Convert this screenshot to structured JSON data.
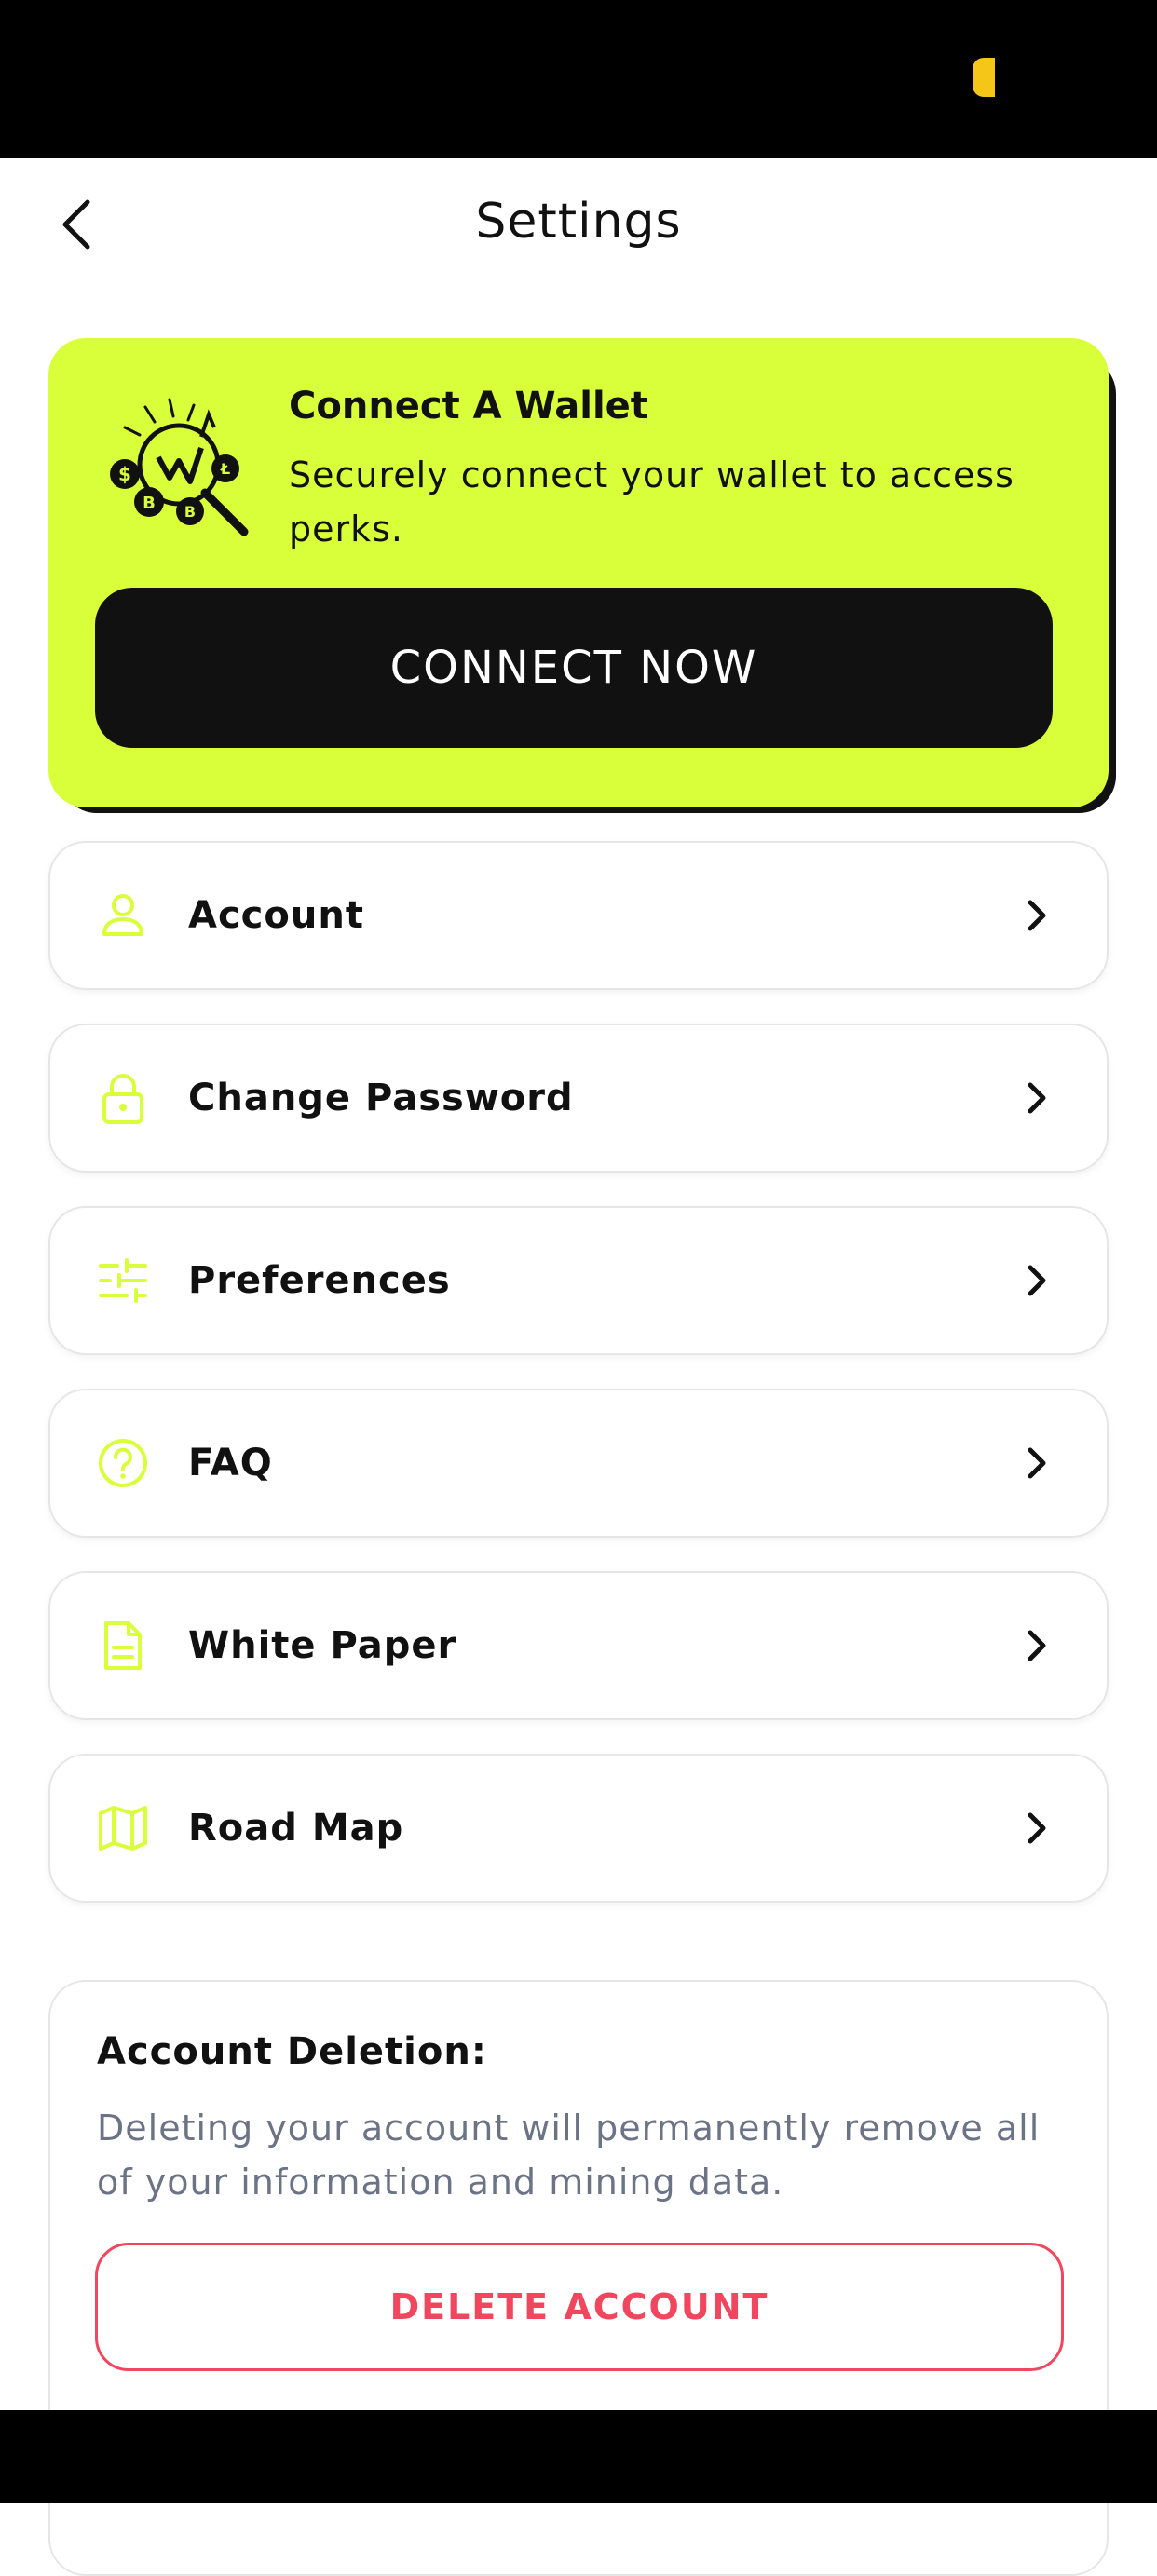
{
  "header": {
    "title": "Settings"
  },
  "wallet": {
    "title": "Connect A Wallet",
    "description": "Securely connect your wallet to access perks.",
    "button_label": "CONNECT NOW"
  },
  "menu": [
    {
      "label": "Account",
      "icon": "user-icon"
    },
    {
      "label": "Change Password",
      "icon": "lock-icon"
    },
    {
      "label": "Preferences",
      "icon": "sliders-icon"
    },
    {
      "label": "FAQ",
      "icon": "help-circle-icon"
    },
    {
      "label": "White Paper",
      "icon": "document-icon"
    },
    {
      "label": "Road Map",
      "icon": "map-icon"
    }
  ],
  "deletion": {
    "title": "Account Deletion:",
    "description": "Deleting your account will permanently remove all of your information and mining data.",
    "button_label": "DELETE ACCOUNT"
  },
  "colors": {
    "accent": "#d9ff3b",
    "dark": "#111111",
    "danger": "#f0465e",
    "muted_text": "#6b7385"
  }
}
